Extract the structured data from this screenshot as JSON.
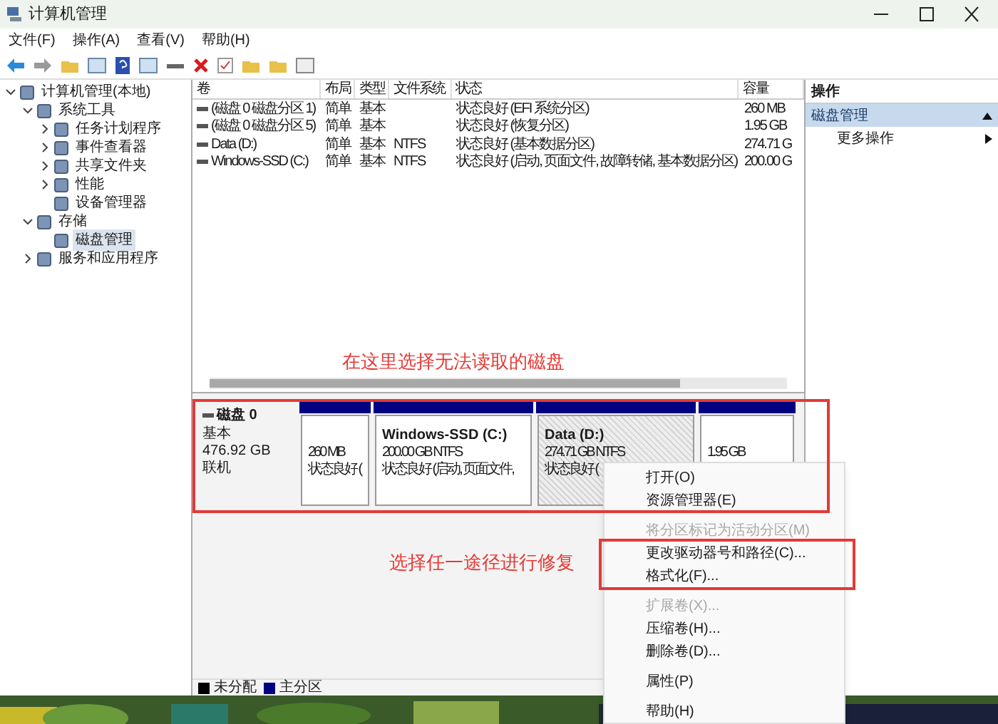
{
  "window": {
    "title": "计算机管理"
  },
  "menu": [
    "文件(F)",
    "操作(A)",
    "查看(V)",
    "帮助(H)"
  ],
  "tree": [
    {
      "label": "计算机管理(本地)",
      "kind": "branch",
      "expanded": true,
      "selected": false,
      "children": [
        {
          "label": "系统工具",
          "kind": "branch",
          "expanded": true,
          "selected": false,
          "children": [
            {
              "label": "任务计划程序",
              "kind": "branch",
              "expanded": false,
              "selected": false
            },
            {
              "label": "事件查看器",
              "kind": "branch",
              "expanded": false,
              "selected": false
            },
            {
              "label": "共享文件夹",
              "kind": "branch",
              "expanded": false,
              "selected": false
            },
            {
              "label": "性能",
              "kind": "branch",
              "expanded": false,
              "selected": false
            },
            {
              "label": "设备管理器",
              "kind": "leaf",
              "selected": false
            }
          ]
        },
        {
          "label": "存储",
          "kind": "branch",
          "expanded": true,
          "selected": false,
          "children": [
            {
              "label": "磁盘管理",
              "kind": "leaf",
              "selected": true
            }
          ]
        },
        {
          "label": "服务和应用程序",
          "kind": "branch",
          "expanded": false,
          "selected": false
        }
      ]
    }
  ],
  "table": {
    "columns": [
      "卷",
      "布局",
      "类型",
      "文件系统",
      "状态",
      "容量"
    ],
    "rows": [
      [
        "(磁盘 0 磁盘分区 1)",
        "简单",
        "基本",
        "",
        "状态良好 (EFI 系统分区)",
        "260 MB"
      ],
      [
        "(磁盘 0 磁盘分区 5)",
        "简单",
        "基本",
        "",
        "状态良好 (恢复分区)",
        "1.95 GB"
      ],
      [
        "Data (D:)",
        "简单",
        "基本",
        "NTFS",
        "状态良好 (基本数据分区)",
        "274.71 G"
      ],
      [
        "Windows-SSD (C:)",
        "简单",
        "基本",
        "NTFS",
        "状态良好 (启动, 页面文件, 故障转储, 基本数据分区)",
        "200.00 G"
      ]
    ]
  },
  "disk": {
    "name": "磁盘 0",
    "lines": [
      "基本",
      "476.92 GB",
      "联机"
    ],
    "partitions": [
      {
        "lines": [
          "260 MB",
          "状态良好 ("
        ],
        "selected": false
      },
      {
        "title": "Windows-SSD  (C:)",
        "lines": [
          "200.00 GB NTFS",
          "状态良好 (启动, 页面文件,"
        ],
        "selected": false
      },
      {
        "title": "Data  (D:)",
        "lines": [
          "274.71 GB NTFS",
          "状态良好 ("
        ],
        "selected": true
      },
      {
        "lines": [
          "1.95 GB"
        ],
        "selected": false
      }
    ]
  },
  "legend": [
    {
      "label": "未分配",
      "color": "#000000"
    },
    {
      "label": "主分区",
      "color": "#000080"
    }
  ],
  "actions": {
    "title": "操作",
    "section": "磁盘管理",
    "items": [
      "更多操作"
    ]
  },
  "annotations": [
    "在这里选择无法读取的磁盘",
    "选择任一途径进行修复"
  ],
  "context_menu": [
    {
      "kind": "item",
      "label": "打开(O)",
      "disabled": false
    },
    {
      "kind": "item",
      "label": "资源管理器(E)",
      "disabled": false
    },
    {
      "kind": "separator"
    },
    {
      "kind": "item",
      "label": "将分区标记为活动分区(M)",
      "disabled": true
    },
    {
      "kind": "item",
      "label": "更改驱动器号和路径(C)...",
      "disabled": false
    },
    {
      "kind": "item",
      "label": "格式化(F)...",
      "disabled": false
    },
    {
      "kind": "separator"
    },
    {
      "kind": "item",
      "label": "扩展卷(X)...",
      "disabled": true
    },
    {
      "kind": "item",
      "label": "压缩卷(H)...",
      "disabled": false
    },
    {
      "kind": "item",
      "label": "删除卷(D)...",
      "disabled": false
    },
    {
      "kind": "separator"
    },
    {
      "kind": "item",
      "label": "属性(P)",
      "disabled": false
    },
    {
      "kind": "separator"
    },
    {
      "kind": "item",
      "label": "帮助(H)",
      "disabled": false
    }
  ]
}
